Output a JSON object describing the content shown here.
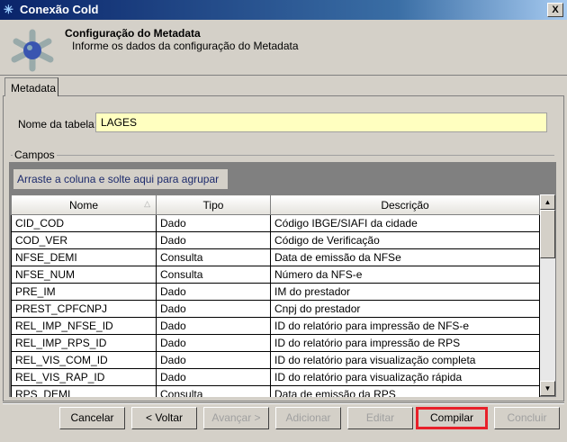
{
  "window": {
    "title": "Conexão Cold",
    "close": "X"
  },
  "header": {
    "title": "Configuração do Metadata",
    "subtitle": "Informe os dados da configuração do Metadata"
  },
  "tabs": [
    {
      "label": "Metadata",
      "active": true
    }
  ],
  "form": {
    "table_name_label": "Nome da tabela:",
    "table_name_value": "LAGES"
  },
  "fields_group": {
    "label": "Campos",
    "group_hint": "Arraste a coluna e solte aqui para agrupar",
    "columns": [
      "Nome",
      "Tipo",
      "Descrição"
    ],
    "rows": [
      [
        "CID_COD",
        "Dado",
        "Código IBGE/SIAFI da cidade"
      ],
      [
        "COD_VER",
        "Dado",
        "Código de Verificação"
      ],
      [
        "NFSE_DEMI",
        "Consulta",
        "Data de emissão da NFSe"
      ],
      [
        "NFSE_NUM",
        "Consulta",
        "Número da NFS-e"
      ],
      [
        "PRE_IM",
        "Dado",
        "IM do prestador"
      ],
      [
        "PREST_CPFCNPJ",
        "Dado",
        "Cnpj do prestador"
      ],
      [
        "REL_IMP_NFSE_ID",
        "Dado",
        "ID do relatório para impressão de NFS-e"
      ],
      [
        "REL_IMP_RPS_ID",
        "Dado",
        "ID do relatório para impressão de RPS"
      ],
      [
        "REL_VIS_COM_ID",
        "Dado",
        "ID do relatório para visualização completa"
      ],
      [
        "REL_VIS_RAP_ID",
        "Dado",
        "ID do relatório para visualização rápida"
      ],
      [
        "RPS_DEMI",
        "Consulta",
        "Data de emissão da RPS"
      ]
    ]
  },
  "buttons": {
    "cancel": "Cancelar",
    "back": "< Voltar",
    "next": "Avançar >",
    "add": "Adicionar",
    "edit": "Editar",
    "compile": "Compilar",
    "finish": "Concluir"
  },
  "colors": {
    "highlight": "#e8202a",
    "input_bg": "#ffffc0"
  }
}
